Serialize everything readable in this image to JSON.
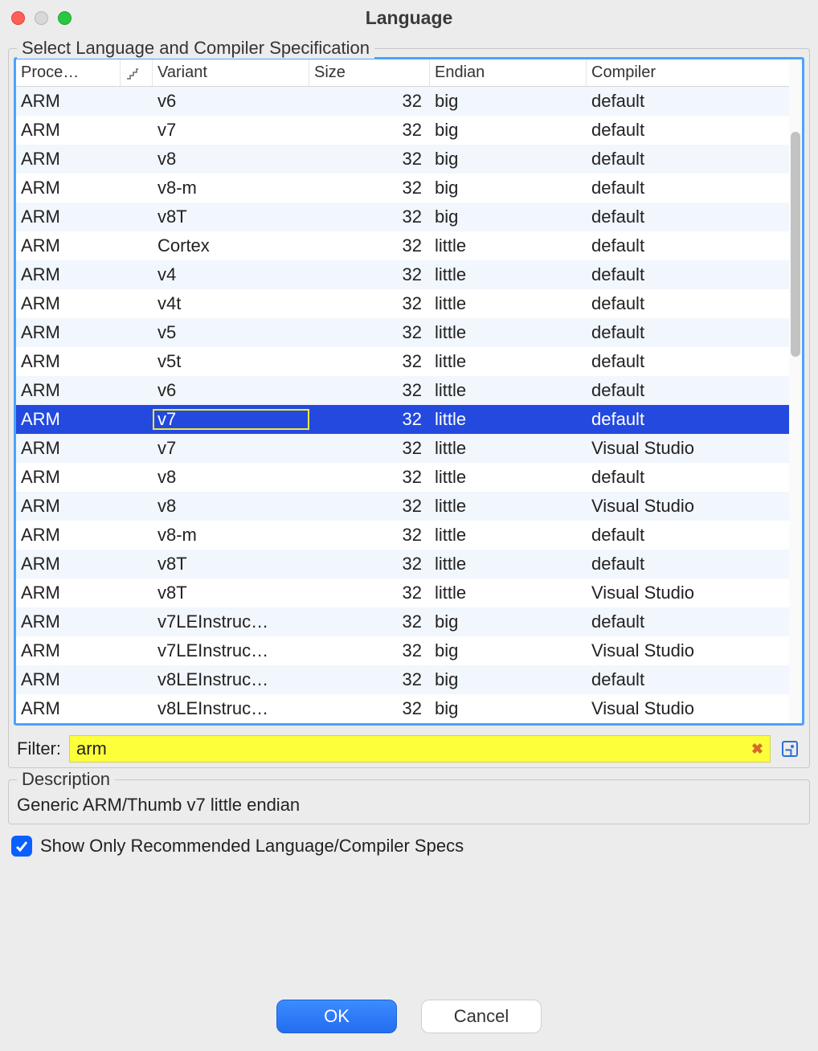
{
  "window": {
    "title": "Language"
  },
  "group": {
    "title": "Select Language and Compiler Specification"
  },
  "columns": {
    "processor": "Proce…",
    "sort_icon": "",
    "variant": "Variant",
    "size": "Size",
    "endian": "Endian",
    "compiler": "Compiler"
  },
  "rows": [
    {
      "processor": "ARM",
      "variant": "v6",
      "size": "32",
      "endian": "big",
      "compiler": "default"
    },
    {
      "processor": "ARM",
      "variant": "v7",
      "size": "32",
      "endian": "big",
      "compiler": "default"
    },
    {
      "processor": "ARM",
      "variant": "v8",
      "size": "32",
      "endian": "big",
      "compiler": "default"
    },
    {
      "processor": "ARM",
      "variant": "v8-m",
      "size": "32",
      "endian": "big",
      "compiler": "default"
    },
    {
      "processor": "ARM",
      "variant": "v8T",
      "size": "32",
      "endian": "big",
      "compiler": "default"
    },
    {
      "processor": "ARM",
      "variant": "Cortex",
      "size": "32",
      "endian": "little",
      "compiler": "default"
    },
    {
      "processor": "ARM",
      "variant": "v4",
      "size": "32",
      "endian": "little",
      "compiler": "default"
    },
    {
      "processor": "ARM",
      "variant": "v4t",
      "size": "32",
      "endian": "little",
      "compiler": "default"
    },
    {
      "processor": "ARM",
      "variant": "v5",
      "size": "32",
      "endian": "little",
      "compiler": "default"
    },
    {
      "processor": "ARM",
      "variant": "v5t",
      "size": "32",
      "endian": "little",
      "compiler": "default"
    },
    {
      "processor": "ARM",
      "variant": "v6",
      "size": "32",
      "endian": "little",
      "compiler": "default"
    },
    {
      "processor": "ARM",
      "variant": "v7",
      "size": "32",
      "endian": "little",
      "compiler": "default",
      "selected": true
    },
    {
      "processor": "ARM",
      "variant": "v7",
      "size": "32",
      "endian": "little",
      "compiler": "Visual Studio"
    },
    {
      "processor": "ARM",
      "variant": "v8",
      "size": "32",
      "endian": "little",
      "compiler": "default"
    },
    {
      "processor": "ARM",
      "variant": "v8",
      "size": "32",
      "endian": "little",
      "compiler": "Visual Studio"
    },
    {
      "processor": "ARM",
      "variant": "v8-m",
      "size": "32",
      "endian": "little",
      "compiler": "default"
    },
    {
      "processor": "ARM",
      "variant": "v8T",
      "size": "32",
      "endian": "little",
      "compiler": "default"
    },
    {
      "processor": "ARM",
      "variant": "v8T",
      "size": "32",
      "endian": "little",
      "compiler": "Visual Studio"
    },
    {
      "processor": "ARM",
      "variant": "v7LEInstruc…",
      "size": "32",
      "endian": "big",
      "compiler": "default"
    },
    {
      "processor": "ARM",
      "variant": "v7LEInstruc…",
      "size": "32",
      "endian": "big",
      "compiler": "Visual Studio"
    },
    {
      "processor": "ARM",
      "variant": "v8LEInstruc…",
      "size": "32",
      "endian": "big",
      "compiler": "default"
    },
    {
      "processor": "ARM",
      "variant": "v8LEInstruc…",
      "size": "32",
      "endian": "big",
      "compiler": "Visual Studio"
    }
  ],
  "filter": {
    "label": "Filter:",
    "value": "arm"
  },
  "description": {
    "label": "Description",
    "text": "Generic ARM/Thumb v7 little endian"
  },
  "checkbox": {
    "label": "Show Only Recommended Language/Compiler Specs",
    "checked": true
  },
  "buttons": {
    "ok": "OK",
    "cancel": "Cancel"
  }
}
